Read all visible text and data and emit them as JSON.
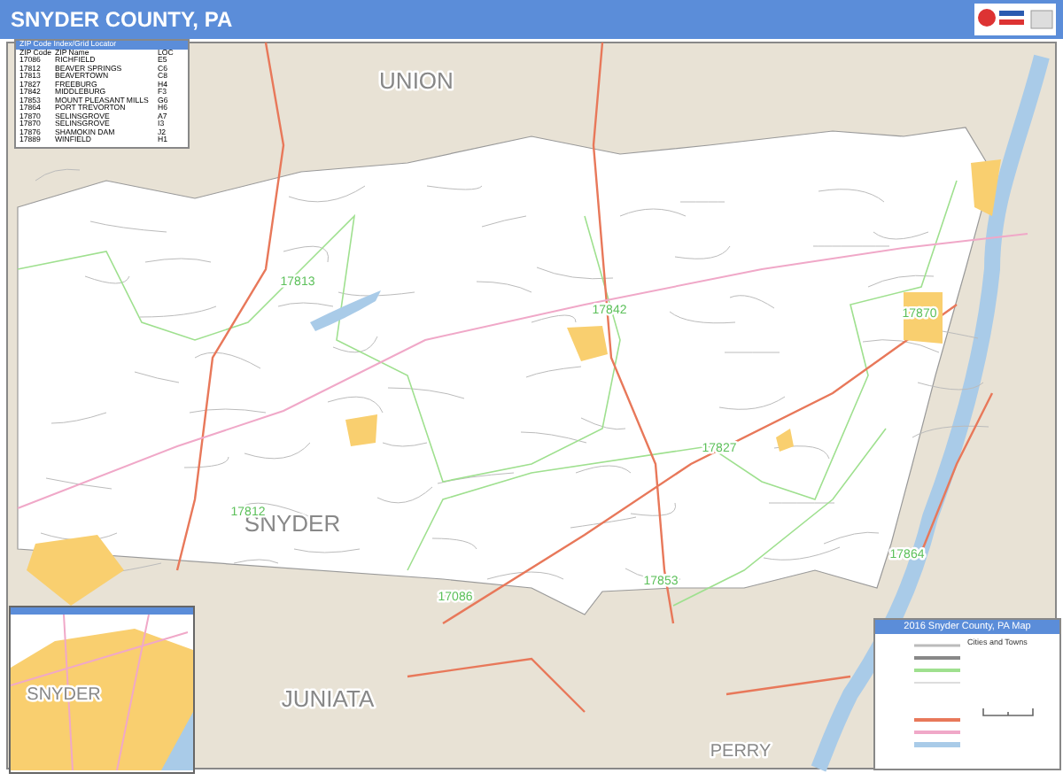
{
  "header": {
    "title": "SNYDER COUNTY, PA"
  },
  "zip_index": {
    "title": "ZIP Code Index/Grid Locator",
    "columns": [
      "ZIP Code",
      "ZIP Name",
      "LOC"
    ],
    "rows": [
      [
        "17086",
        "RICHFIELD",
        "E5"
      ],
      [
        "17812",
        "BEAVER SPRINGS",
        "C6"
      ],
      [
        "17813",
        "BEAVERTOWN",
        "C8"
      ],
      [
        "17827",
        "FREEBURG",
        "H4"
      ],
      [
        "17842",
        "MIDDLEBURG",
        "F3"
      ],
      [
        "17853",
        "MOUNT PLEASANT MILLS",
        "G6"
      ],
      [
        "17864",
        "PORT TREVORTON",
        "H6"
      ],
      [
        "17870",
        "SELINSGROVE",
        "A7"
      ],
      [
        "17870",
        "SELINSGROVE",
        "I3"
      ],
      [
        "17876",
        "SHAMOKIN DAM",
        "J2"
      ],
      [
        "17889",
        "WINFIELD",
        "H1"
      ]
    ]
  },
  "county_labels": [
    "UNION",
    "SNYDER",
    "JUNIATA",
    "PERRY"
  ],
  "zip_labels": [
    "17813",
    "17842",
    "17870",
    "17827",
    "17812",
    "17864",
    "17853",
    "17086"
  ],
  "inset": {
    "label": "SNYDER"
  },
  "legend": {
    "title": "2016 Snyder County, PA Map",
    "cities_heading": "Cities and Towns"
  }
}
